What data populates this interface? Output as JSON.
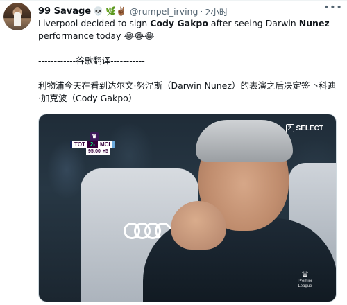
{
  "tweet": {
    "display_name": "99 Savage",
    "name_emojis": [
      "💀",
      "🌿",
      "✌🏾"
    ],
    "handle": "@rumpel_irving",
    "separator": "·",
    "time": "2小时",
    "more_icon": "more-horizontal-icon",
    "text": {
      "line1_pre": "Liverpool decided to sign ",
      "line1_bold": "Cody Gakpo",
      "line1_mid": " after seeing Darwin ",
      "line1_bold2": "Nunez",
      "line2": "performance today",
      "laugh_emojis": "😂😂😂",
      "translation_sep": "------------谷歌翻译-----------",
      "translation_line1": "利物浦今天在看到达尔文·努涅斯（Darwin Nunez）的表演之后决定签下科迪",
      "translation_line2": "·加克波（Cody Gakpo）"
    }
  },
  "media": {
    "scoreboard": {
      "league_badge": "♛",
      "home_team": "TOT",
      "score": "2-0",
      "away_team": "MCI",
      "clock": "95:00",
      "added_time": "+5"
    },
    "broadcaster": {
      "logo_letter": "Z",
      "label": "SELECT"
    },
    "watermark": {
      "line1": "Premier",
      "line2": "League"
    }
  }
}
